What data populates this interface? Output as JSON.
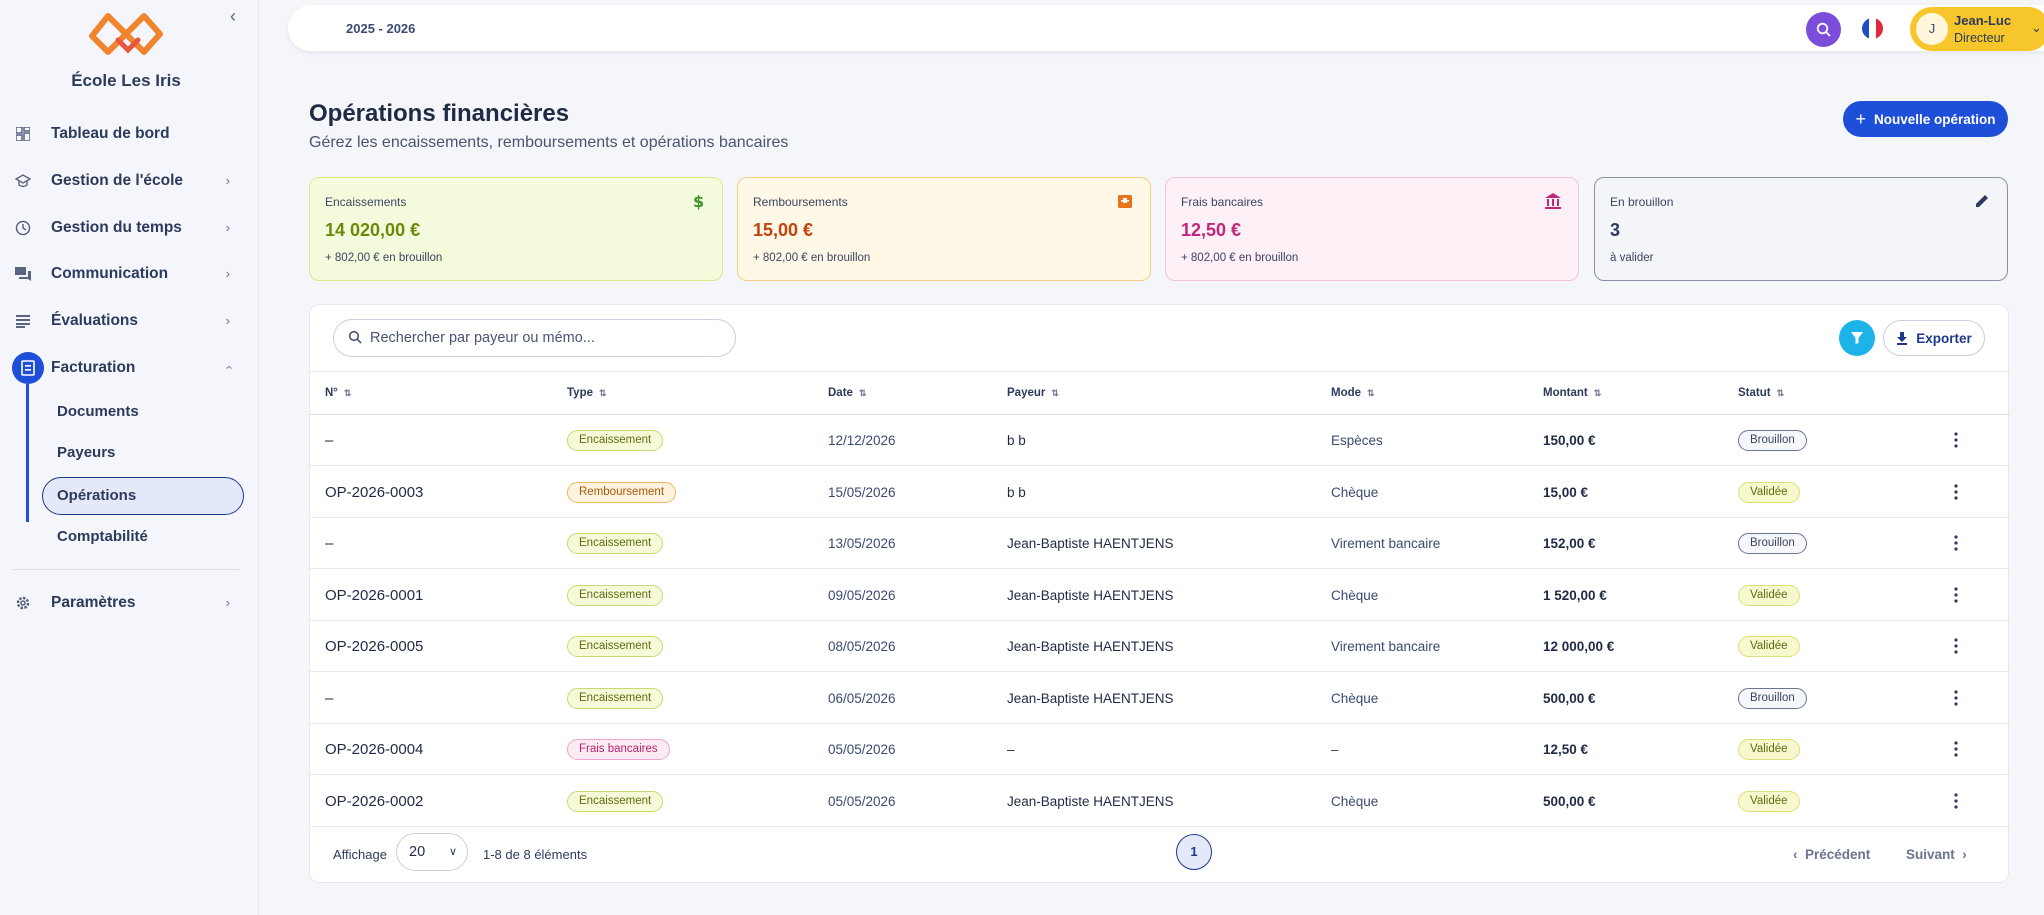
{
  "sidebar": {
    "school_name": "École Les Iris",
    "items": [
      {
        "label": "Tableau de bord"
      },
      {
        "label": "Gestion de l'école"
      },
      {
        "label": "Gestion du temps"
      },
      {
        "label": "Communication"
      },
      {
        "label": "Évaluations"
      },
      {
        "label": "Facturation"
      },
      {
        "label": "Paramètres"
      }
    ],
    "facturation_sub": [
      {
        "label": "Documents"
      },
      {
        "label": "Payeurs"
      },
      {
        "label": "Opérations"
      },
      {
        "label": "Comptabilité"
      }
    ]
  },
  "topbar": {
    "year": "2025 - 2026",
    "user": {
      "initial": "J",
      "name": "Jean-Luc",
      "role": "Directeur"
    }
  },
  "header": {
    "title": "Opérations financières",
    "subtitle": "Gérez les encaissements, remboursements et opérations bancaires",
    "new_button": "Nouvelle opération"
  },
  "cards": [
    {
      "label": "Encaissements",
      "value": "14 020,00 €",
      "note": "+ 802,00 € en brouillon",
      "color": "#6b8a0a"
    },
    {
      "label": "Remboursements",
      "value": "15,00 €",
      "note": "+ 802,00 € en brouillon",
      "color": "#c2410c"
    },
    {
      "label": "Frais bancaires",
      "value": "12,50 €",
      "note": "+ 802,00 € en brouillon",
      "color": "#c0267a"
    },
    {
      "label": "En brouillon",
      "value": "3",
      "note": "à valider",
      "color": "#2c3a5c"
    }
  ],
  "toolbar": {
    "search_placeholder": "Rechercher par payeur ou mémo...",
    "export_label": "Exporter"
  },
  "table": {
    "columns": [
      "N°",
      "Type",
      "Date",
      "Payeur",
      "Mode",
      "Montant",
      "Statut"
    ],
    "rows": [
      {
        "num": "–",
        "type": "Encaissement",
        "date": "12/12/2026",
        "payeur": "b b",
        "mode": "Espèces",
        "montant": "150,00 €",
        "statut": "Brouillon"
      },
      {
        "num": "OP-2026-0003",
        "type": "Remboursement",
        "date": "15/05/2026",
        "payeur": "b b",
        "mode": "Chèque",
        "montant": "15,00 €",
        "statut": "Validée"
      },
      {
        "num": "–",
        "type": "Encaissement",
        "date": "13/05/2026",
        "payeur": "Jean-Baptiste HAENTJENS",
        "mode": "Virement bancaire",
        "montant": "152,00 €",
        "statut": "Brouillon"
      },
      {
        "num": "OP-2026-0001",
        "type": "Encaissement",
        "date": "09/05/2026",
        "payeur": "Jean-Baptiste HAENTJENS",
        "mode": "Chèque",
        "montant": "1 520,00 €",
        "statut": "Validée"
      },
      {
        "num": "OP-2026-0005",
        "type": "Encaissement",
        "date": "08/05/2026",
        "payeur": "Jean-Baptiste HAENTJENS",
        "mode": "Virement bancaire",
        "montant": "12 000,00 €",
        "statut": "Validée"
      },
      {
        "num": "–",
        "type": "Encaissement",
        "date": "06/05/2026",
        "payeur": "Jean-Baptiste HAENTJENS",
        "mode": "Chèque",
        "montant": "500,00 €",
        "statut": "Brouillon"
      },
      {
        "num": "OP-2026-0004",
        "type": "Frais bancaires",
        "date": "05/05/2026",
        "payeur": "–",
        "mode": "–",
        "montant": "12,50 €",
        "statut": "Validée"
      },
      {
        "num": "OP-2026-0002",
        "type": "Encaissement",
        "date": "05/05/2026",
        "payeur": "Jean-Baptiste HAENTJENS",
        "mode": "Chèque",
        "montant": "500,00 €",
        "statut": "Validée"
      }
    ]
  },
  "pagination": {
    "display_label": "Affichage",
    "page_size": "20",
    "range": "1-8 de 8 éléments",
    "current_page": "1",
    "prev": "Précédent",
    "next": "Suivant"
  }
}
